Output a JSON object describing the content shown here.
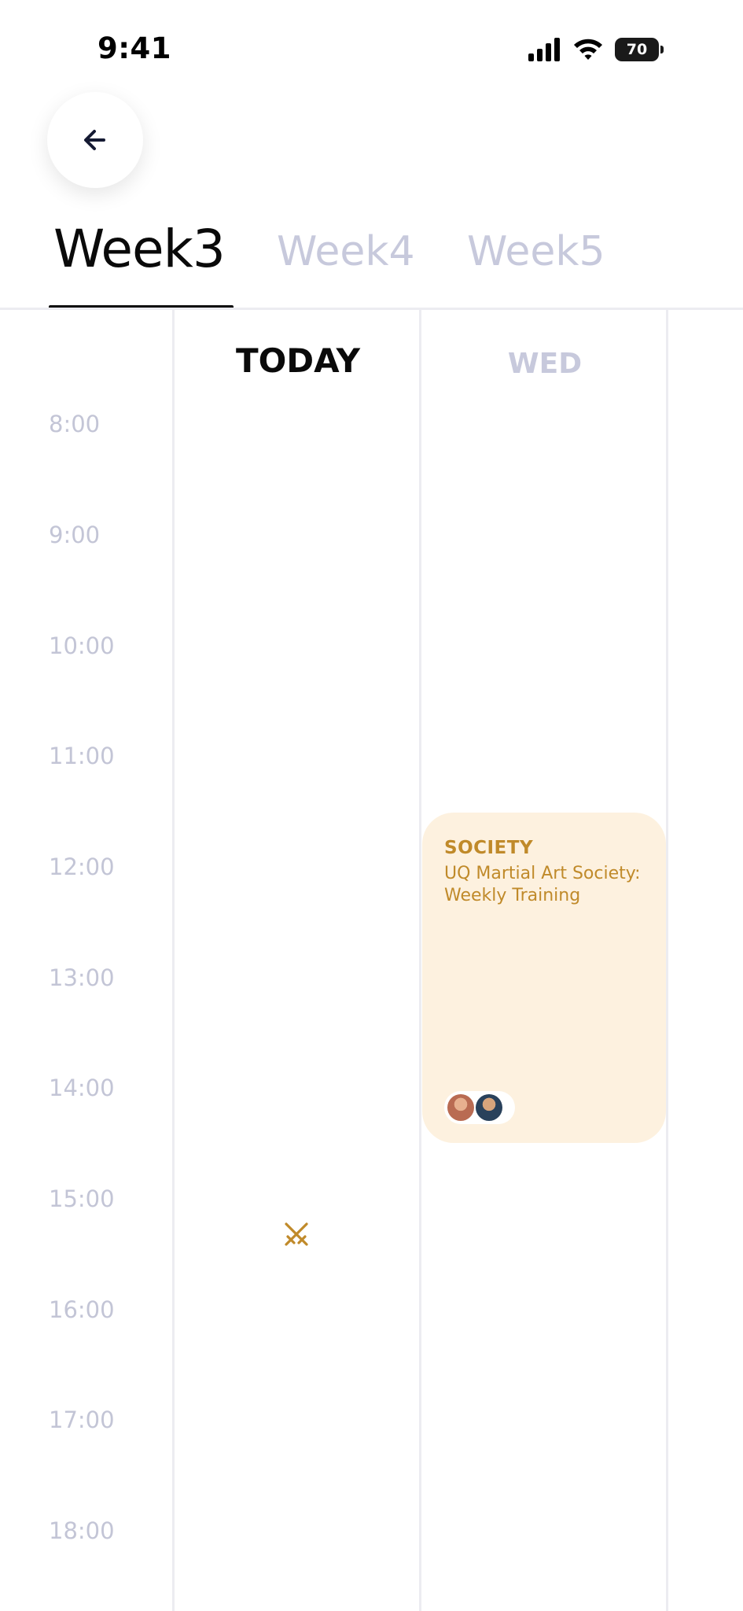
{
  "status_bar": {
    "time": "9:41",
    "battery_level": "70"
  },
  "nav": {
    "back_icon": "arrow-left-icon"
  },
  "week_tabs": [
    {
      "label": "Week3",
      "active": true
    },
    {
      "label": "Week4",
      "active": false
    },
    {
      "label": "Week5",
      "active": false
    }
  ],
  "days": {
    "today": "TODAY",
    "wed": "WED"
  },
  "times": [
    "8:00",
    "9:00",
    "10:00",
    "11:00",
    "12:00",
    "13:00",
    "14:00",
    "15:00",
    "16:00",
    "17:00",
    "18:00"
  ],
  "event": {
    "category": "SOCIETY",
    "title": "UQ Martial Art Society: Weekly Training",
    "attendee_count": 2
  },
  "colors": {
    "accent": "#c08a2a",
    "event_bg": "#fdf1df",
    "inactive_text": "#c7c9dc",
    "time_text": "#c3c5d6",
    "active_text": "#0a0a0a"
  },
  "icons": {
    "today_marker": "crossed-swords-icon"
  }
}
